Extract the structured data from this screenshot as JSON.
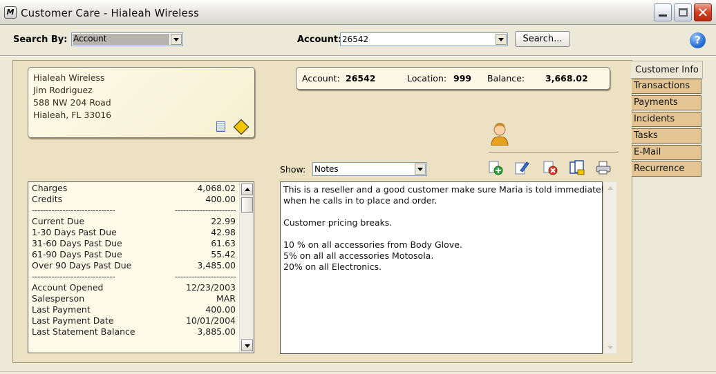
{
  "window": {
    "title": "Customer Care - Hialeah Wireless",
    "app_icon_letter": "M"
  },
  "search": {
    "search_by_label": "Search By:",
    "search_by_value": "Account",
    "account_label": "Account:",
    "account_value": "26542",
    "search_button": "Search...",
    "help_icon": "?"
  },
  "address": {
    "lines": [
      "Hialeah Wireless",
      "Jim  Rodriguez",
      "588 NW 204 Road",
      "Hialeah, FL 33016"
    ]
  },
  "summary": {
    "account_label": "Account:",
    "account_value": "26542",
    "location_label": "Location:",
    "location_value": "999",
    "balance_label": "Balance:",
    "balance_value": "3,668.02"
  },
  "show": {
    "label": "Show:",
    "value": "Notes"
  },
  "balances": [
    {
      "label": "Charges",
      "value": "4,068.02"
    },
    {
      "label": "Credits",
      "value": "400.00"
    },
    {
      "label": "------------------------------",
      "value": "----------------------"
    },
    {
      "label": "Current Due",
      "value": "22.99"
    },
    {
      "label": "1-30 Days Past Due",
      "value": "42.98"
    },
    {
      "label": "31-60 Days Past Due",
      "value": "61.63"
    },
    {
      "label": "61-90 Days Past Due",
      "value": "55.42"
    },
    {
      "label": "Over 90 Days Past Due",
      "value": "3,485.00"
    },
    {
      "label": "------------------------------",
      "value": "----------------------"
    },
    {
      "label": "Account Opened",
      "value": "12/23/2003"
    },
    {
      "label": "Salesperson",
      "value": "MAR"
    },
    {
      "label": "Last Payment",
      "value": "400.00"
    },
    {
      "label": "Last Payment Date",
      "value": "10/01/2004"
    },
    {
      "label": "Last Statement Balance",
      "value": "3,885.00"
    }
  ],
  "notes": [
    "This is a reseller and a good customer make sure Maria is told immediately",
    "when he calls in to place and order.",
    "",
    "Customer pricing breaks.",
    "",
    "10 % on all accessories from Body Glove.",
    "5% on all  all accessories Motosola.",
    "20% on all  Electronics."
  ],
  "tabs": [
    "Customer Info",
    "Transactions",
    "Payments",
    "Incidents",
    "Tasks",
    "E-Mail",
    "Recurrence"
  ],
  "toolbar_icons": [
    "add-note-icon",
    "edit-note-icon",
    "delete-note-icon",
    "copy-note-icon",
    "print-icon"
  ],
  "colors": {
    "panel": "#ece2c3",
    "card": "#fefbe9",
    "tab": "#e4c594"
  }
}
